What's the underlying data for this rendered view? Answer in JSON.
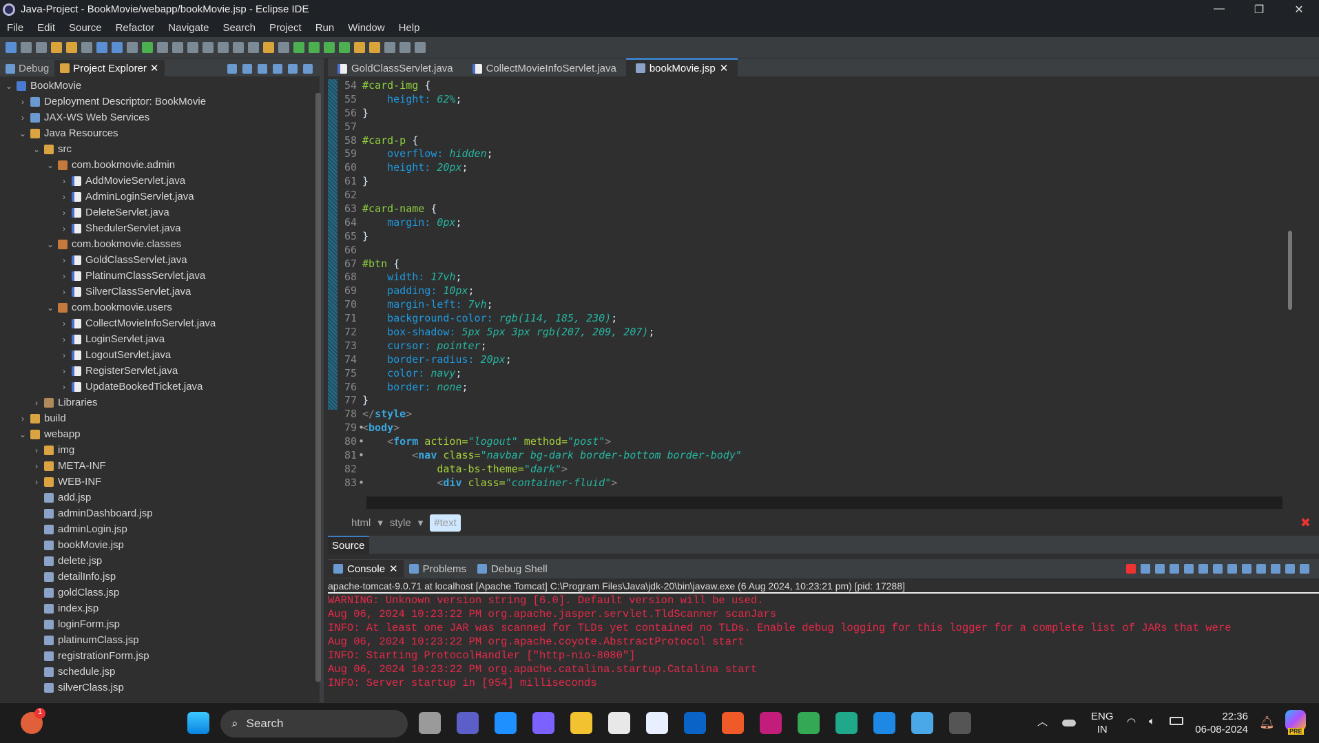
{
  "window": {
    "title": "Java-Project - BookMovie/webapp/bookMovie.jsp - Eclipse IDE",
    "minimize": "—",
    "restore": "❐",
    "close": "✕"
  },
  "menu": [
    "File",
    "Edit",
    "Source",
    "Refactor",
    "Navigate",
    "Search",
    "Project",
    "Run",
    "Window",
    "Help"
  ],
  "left_tabs": [
    {
      "label": "Debug",
      "icon": "bug-icon"
    },
    {
      "label": "Project Explorer",
      "icon": "project-explorer-icon",
      "close": "✕"
    }
  ],
  "tree": [
    {
      "label": "BookMovie",
      "level": 0,
      "twisty": "⌄",
      "icon": "proj"
    },
    {
      "label": "Deployment Descriptor: BookMovie",
      "level": 1,
      "twisty": "›",
      "icon": "ws"
    },
    {
      "label": "JAX-WS Web Services",
      "level": 1,
      "twisty": "›",
      "icon": "ws"
    },
    {
      "label": "Java Resources",
      "level": 1,
      "twisty": "⌄",
      "icon": "folder"
    },
    {
      "label": "src",
      "level": 2,
      "twisty": "⌄",
      "icon": "folder"
    },
    {
      "label": "com.bookmovie.admin",
      "level": 3,
      "twisty": "⌄",
      "icon": "pkg"
    },
    {
      "label": "AddMovieServlet.java",
      "level": 4,
      "twisty": "›",
      "icon": "java"
    },
    {
      "label": "AdminLoginServlet.java",
      "level": 4,
      "twisty": "›",
      "icon": "java"
    },
    {
      "label": "DeleteServlet.java",
      "level": 4,
      "twisty": "›",
      "icon": "java"
    },
    {
      "label": "ShedulerServlet.java",
      "level": 4,
      "twisty": "›",
      "icon": "java"
    },
    {
      "label": "com.bookmovie.classes",
      "level": 3,
      "twisty": "⌄",
      "icon": "pkg"
    },
    {
      "label": "GoldClassServlet.java",
      "level": 4,
      "twisty": "›",
      "icon": "java"
    },
    {
      "label": "PlatinumClassServlet.java",
      "level": 4,
      "twisty": "›",
      "icon": "java"
    },
    {
      "label": "SilverClassServlet.java",
      "level": 4,
      "twisty": "›",
      "icon": "java"
    },
    {
      "label": "com.bookmovie.users",
      "level": 3,
      "twisty": "⌄",
      "icon": "pkg"
    },
    {
      "label": "CollectMovieInfoServlet.java",
      "level": 4,
      "twisty": "›",
      "icon": "java"
    },
    {
      "label": "LoginServlet.java",
      "level": 4,
      "twisty": "›",
      "icon": "java"
    },
    {
      "label": "LogoutServlet.java",
      "level": 4,
      "twisty": "›",
      "icon": "java"
    },
    {
      "label": "RegisterServlet.java",
      "level": 4,
      "twisty": "›",
      "icon": "java"
    },
    {
      "label": "UpdateBookedTicket.java",
      "level": 4,
      "twisty": "›",
      "icon": "java"
    },
    {
      "label": "Libraries",
      "level": 2,
      "twisty": "›",
      "icon": "lib"
    },
    {
      "label": "build",
      "level": 1,
      "twisty": "›",
      "icon": "folder"
    },
    {
      "label": "webapp",
      "level": 1,
      "twisty": "⌄",
      "icon": "folder"
    },
    {
      "label": "img",
      "level": 2,
      "twisty": "›",
      "icon": "folder"
    },
    {
      "label": "META-INF",
      "level": 2,
      "twisty": "›",
      "icon": "folder"
    },
    {
      "label": "WEB-INF",
      "level": 2,
      "twisty": "›",
      "icon": "folder"
    },
    {
      "label": "add.jsp",
      "level": 2,
      "twisty": "",
      "icon": "jsp"
    },
    {
      "label": "adminDashboard.jsp",
      "level": 2,
      "twisty": "",
      "icon": "jsp"
    },
    {
      "label": "adminLogin.jsp",
      "level": 2,
      "twisty": "",
      "icon": "jsp"
    },
    {
      "label": "bookMovie.jsp",
      "level": 2,
      "twisty": "",
      "icon": "jsp"
    },
    {
      "label": "delete.jsp",
      "level": 2,
      "twisty": "",
      "icon": "jsp"
    },
    {
      "label": "detailInfo.jsp",
      "level": 2,
      "twisty": "",
      "icon": "jsp"
    },
    {
      "label": "goldClass.jsp",
      "level": 2,
      "twisty": "",
      "icon": "jsp"
    },
    {
      "label": "index.jsp",
      "level": 2,
      "twisty": "",
      "icon": "jsp"
    },
    {
      "label": "loginForm.jsp",
      "level": 2,
      "twisty": "",
      "icon": "jsp"
    },
    {
      "label": "platinumClass.jsp",
      "level": 2,
      "twisty": "",
      "icon": "jsp"
    },
    {
      "label": "registrationForm.jsp",
      "level": 2,
      "twisty": "",
      "icon": "jsp"
    },
    {
      "label": "schedule.jsp",
      "level": 2,
      "twisty": "",
      "icon": "jsp"
    },
    {
      "label": "silverClass.jsp",
      "level": 2,
      "twisty": "",
      "icon": "jsp"
    }
  ],
  "editor_tabs": [
    {
      "label": "GoldClassServlet.java",
      "active": false
    },
    {
      "label": "CollectMovieInfoServlet.java",
      "active": false
    },
    {
      "label": "bookMovie.jsp",
      "active": true,
      "close": "✕"
    }
  ],
  "code": [
    {
      "n": "54",
      "t": [
        [
          "sel",
          "#card-img "
        ],
        [
          "punc",
          "{"
        ]
      ]
    },
    {
      "n": "55",
      "t": [
        [
          "punc",
          "    "
        ],
        [
          "prop",
          "height: "
        ],
        [
          "val",
          "62%"
        ],
        [
          "punc",
          ";"
        ]
      ]
    },
    {
      "n": "56",
      "t": [
        [
          "punc",
          "}"
        ]
      ]
    },
    {
      "n": "57",
      "t": []
    },
    {
      "n": "58",
      "t": [
        [
          "sel",
          "#card-p "
        ],
        [
          "punc",
          "{"
        ]
      ]
    },
    {
      "n": "59",
      "t": [
        [
          "punc",
          "    "
        ],
        [
          "prop",
          "overflow: "
        ],
        [
          "val",
          "hidden"
        ],
        [
          "punc",
          ";"
        ]
      ]
    },
    {
      "n": "60",
      "t": [
        [
          "punc",
          "    "
        ],
        [
          "prop",
          "height: "
        ],
        [
          "val",
          "20px"
        ],
        [
          "punc",
          ";"
        ]
      ]
    },
    {
      "n": "61",
      "t": [
        [
          "punc",
          "}"
        ]
      ]
    },
    {
      "n": "62",
      "t": []
    },
    {
      "n": "63",
      "t": [
        [
          "sel",
          "#card-name "
        ],
        [
          "punc",
          "{"
        ]
      ]
    },
    {
      "n": "64",
      "t": [
        [
          "punc",
          "    "
        ],
        [
          "prop",
          "margin: "
        ],
        [
          "val",
          "0px"
        ],
        [
          "punc",
          ";"
        ]
      ]
    },
    {
      "n": "65",
      "t": [
        [
          "punc",
          "}"
        ]
      ]
    },
    {
      "n": "66",
      "t": []
    },
    {
      "n": "67",
      "t": [
        [
          "sel",
          "#btn "
        ],
        [
          "punc",
          "{"
        ]
      ]
    },
    {
      "n": "68",
      "t": [
        [
          "punc",
          "    "
        ],
        [
          "prop",
          "width: "
        ],
        [
          "val",
          "17vh"
        ],
        [
          "punc",
          ";"
        ]
      ]
    },
    {
      "n": "69",
      "t": [
        [
          "punc",
          "    "
        ],
        [
          "prop",
          "padding: "
        ],
        [
          "val",
          "10px"
        ],
        [
          "punc",
          ";"
        ]
      ]
    },
    {
      "n": "70",
      "t": [
        [
          "punc",
          "    "
        ],
        [
          "prop",
          "margin-left: "
        ],
        [
          "val",
          "7vh"
        ],
        [
          "punc",
          ";"
        ]
      ]
    },
    {
      "n": "71",
      "t": [
        [
          "punc",
          "    "
        ],
        [
          "prop",
          "background-color: "
        ],
        [
          "val",
          "rgb(114, 185, 230)"
        ],
        [
          "punc",
          ";"
        ]
      ]
    },
    {
      "n": "72",
      "t": [
        [
          "punc",
          "    "
        ],
        [
          "prop",
          "box-shadow: "
        ],
        [
          "val",
          "5px 5px 3px rgb(207, 209, 207)"
        ],
        [
          "punc",
          ";"
        ]
      ]
    },
    {
      "n": "73",
      "t": [
        [
          "punc",
          "    "
        ],
        [
          "prop",
          "cursor: "
        ],
        [
          "val",
          "pointer"
        ],
        [
          "punc",
          ";"
        ]
      ]
    },
    {
      "n": "74",
      "t": [
        [
          "punc",
          "    "
        ],
        [
          "prop",
          "border-radius: "
        ],
        [
          "val",
          "20px"
        ],
        [
          "punc",
          ";"
        ]
      ]
    },
    {
      "n": "75",
      "t": [
        [
          "punc",
          "    "
        ],
        [
          "prop",
          "color: "
        ],
        [
          "val",
          "navy"
        ],
        [
          "punc",
          ";"
        ]
      ]
    },
    {
      "n": "76",
      "t": [
        [
          "punc",
          "    "
        ],
        [
          "prop",
          "border: "
        ],
        [
          "val",
          "none"
        ],
        [
          "punc",
          ";"
        ]
      ]
    },
    {
      "n": "77",
      "t": [
        [
          "punc",
          "}"
        ]
      ]
    },
    {
      "n": "78",
      "t": [
        [
          "br",
          "</"
        ],
        [
          "tag",
          "style"
        ],
        [
          "br",
          ">"
        ]
      ]
    },
    {
      "n": "79",
      "fold": true,
      "t": [
        [
          "br",
          "<"
        ],
        [
          "tag",
          "body"
        ],
        [
          "br",
          ">"
        ]
      ]
    },
    {
      "n": "80",
      "fold": true,
      "t": [
        [
          "punc",
          "    "
        ],
        [
          "br",
          "<"
        ],
        [
          "tag",
          "form"
        ],
        [
          "attr",
          " action="
        ],
        [
          "str",
          "\"logout\""
        ],
        [
          "attr",
          " method="
        ],
        [
          "str",
          "\"post\""
        ],
        [
          "br",
          ">"
        ]
      ]
    },
    {
      "n": "81",
      "fold": true,
      "t": [
        [
          "punc",
          "        "
        ],
        [
          "br",
          "<"
        ],
        [
          "tag",
          "nav"
        ],
        [
          "attr",
          " class="
        ],
        [
          "str",
          "\"navbar bg-dark border-bottom border-body\""
        ]
      ]
    },
    {
      "n": "82",
      "t": [
        [
          "punc",
          "            "
        ],
        [
          "attr",
          "data-bs-theme="
        ],
        [
          "str",
          "\"dark\""
        ],
        [
          "br",
          ">"
        ]
      ]
    },
    {
      "n": "83",
      "fold": true,
      "t": [
        [
          "punc",
          "            "
        ],
        [
          "br",
          "<"
        ],
        [
          "tag",
          "div"
        ],
        [
          "attr",
          " class="
        ],
        [
          "str",
          "\"container-fluid\""
        ],
        [
          "br",
          ">"
        ]
      ]
    }
  ],
  "breadcrumb": {
    "items": [
      "html",
      "style"
    ],
    "selected": "#text"
  },
  "source_tab": "Source",
  "console_tabs": [
    {
      "label": "Console",
      "active": true,
      "close": "✕"
    },
    {
      "label": "Problems"
    },
    {
      "label": "Debug Shell"
    }
  ],
  "console": {
    "header": "apache-tomcat-9.0.71 at localhost [Apache Tomcat] C:\\Program Files\\Java\\jdk-20\\bin\\javaw.exe  (6 Aug 2024, 10:23:21 pm) [pid: 17288]",
    "lines": [
      "WARNING: Unknown version string [6.0]. Default version will be used.",
      "Aug 06, 2024 10:23:22 PM org.apache.jasper.servlet.TldScanner scanJars",
      "INFO: At least one JAR was scanned for TLDs yet contained no TLDs. Enable debug logging for this logger for a complete list of JARs that were",
      "Aug 06, 2024 10:23:22 PM org.apache.coyote.AbstractProtocol start",
      "INFO: Starting ProtocolHandler [\"http-nio-8080\"]",
      "Aug 06, 2024 10:23:22 PM org.apache.catalina.startup.Catalina start",
      "INFO: Server startup in [954] milliseconds"
    ]
  },
  "taskbar": {
    "search_placeholder": "Search",
    "notification_badge": "1",
    "apps": [
      {
        "name": "task-view",
        "color": "#9a9a9a"
      },
      {
        "name": "teams",
        "color": "#5b5fc7"
      },
      {
        "name": "get-help",
        "color": "#1e90ff"
      },
      {
        "name": "copilot",
        "color": "#7b61ff"
      },
      {
        "name": "file-explorer",
        "color": "#f2c230"
      },
      {
        "name": "microsoft-store",
        "color": "#e8e8e8"
      },
      {
        "name": "android-studio",
        "color": "#e8f0ff"
      },
      {
        "name": "outlook-new",
        "color": "#0a64c8"
      },
      {
        "name": "brave",
        "color": "#f05a28"
      },
      {
        "name": "intellij-idea",
        "color": "#c21d7a"
      },
      {
        "name": "chrome",
        "color": "#34a853"
      },
      {
        "name": "edge",
        "color": "#1fa88a"
      },
      {
        "name": "vscode",
        "color": "#1e88e5"
      },
      {
        "name": "photos",
        "color": "#4aa8e8"
      },
      {
        "name": "eclipse",
        "color": "#555555"
      }
    ],
    "lang": "ENG",
    "region": "IN",
    "time": "22:36",
    "date": "06-08-2024",
    "copilot_badge": "PRE"
  }
}
